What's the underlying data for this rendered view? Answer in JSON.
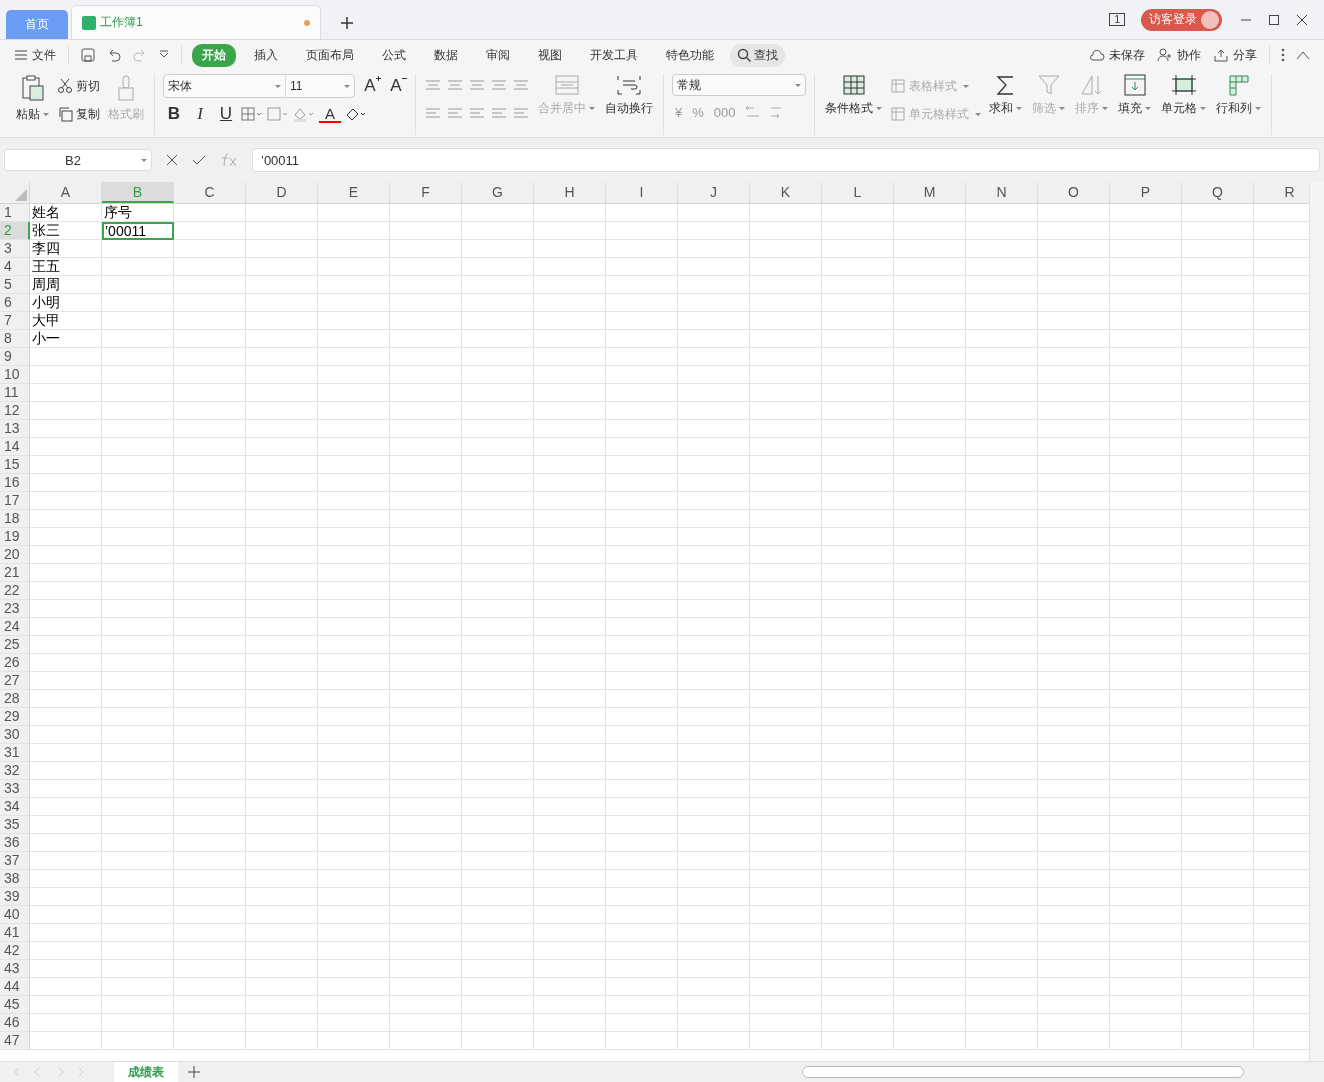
{
  "tabs": [
    {
      "label": "首页",
      "kind": "home",
      "selected": false,
      "modified": false
    },
    {
      "label": "工作簿1",
      "kind": "sheet",
      "selected": true,
      "modified": true
    }
  ],
  "title_bar": {
    "window_count": "1",
    "login": "访客登录"
  },
  "menu": {
    "file": "文件",
    "tabs": [
      {
        "label": "开始",
        "selected": true
      },
      {
        "label": "插入",
        "selected": false
      },
      {
        "label": "页面布局",
        "selected": false
      },
      {
        "label": "公式",
        "selected": false
      },
      {
        "label": "数据",
        "selected": false
      },
      {
        "label": "审阅",
        "selected": false
      },
      {
        "label": "视图",
        "selected": false
      },
      {
        "label": "开发工具",
        "selected": false
      },
      {
        "label": "特色功能",
        "selected": false
      }
    ],
    "search": "查找",
    "actions": [
      {
        "label": "未保存",
        "kind": "cloud"
      },
      {
        "label": "协作",
        "kind": "people"
      },
      {
        "label": "分享",
        "kind": "share"
      }
    ]
  },
  "ribbon": {
    "paste": "粘贴",
    "cut": "剪切",
    "copy": "复制",
    "format_painter": {
      "label": "格式刷",
      "disabled": true
    },
    "font": "宋体",
    "font_size": "11",
    "grow_font": "A",
    "shrink_font": "A",
    "styles": [
      "B",
      "I",
      "U"
    ],
    "font_color": {
      "label": "A",
      "color": "#ff0000"
    },
    "merge": {
      "label": "合并居中",
      "disabled": true
    },
    "wrap": {
      "label": "自动换行",
      "disabled": false
    },
    "number_format": "常规",
    "number_buttons": [
      "¥",
      "%",
      "000"
    ],
    "tools": [
      {
        "label": "条件格式",
        "kind": "grid",
        "disabled": false
      },
      {
        "label": "求和",
        "kind": "sum",
        "disabled": false
      },
      {
        "label": "筛选",
        "kind": "filter",
        "disabled": true
      },
      {
        "label": "排序",
        "kind": "sort",
        "disabled": true
      },
      {
        "label": "填充",
        "kind": "fill",
        "disabled": false
      },
      {
        "label": "单元格",
        "kind": "cell",
        "disabled": false
      },
      {
        "label": "行和列",
        "kind": "rowcol",
        "disabled": false
      }
    ],
    "styles_small": [
      {
        "label": "表格样式",
        "disabled": true
      },
      {
        "label": "单元格样式",
        "disabled": true
      }
    ]
  },
  "formula_bar": {
    "name_box": "B2",
    "value": "’00011"
  },
  "sheet": {
    "columns": [
      {
        "label": "A",
        "selected": false
      },
      {
        "label": "B",
        "selected": true
      },
      {
        "label": "C",
        "selected": false
      },
      {
        "label": "D",
        "selected": false
      },
      {
        "label": "E",
        "selected": false
      },
      {
        "label": "F",
        "selected": false
      },
      {
        "label": "G",
        "selected": false
      },
      {
        "label": "H",
        "selected": false
      },
      {
        "label": "I",
        "selected": false
      },
      {
        "label": "J",
        "selected": false
      },
      {
        "label": "K",
        "selected": false
      },
      {
        "label": "L",
        "selected": false
      },
      {
        "label": "M",
        "selected": false
      },
      {
        "label": "N",
        "selected": false
      },
      {
        "label": "O",
        "selected": false
      },
      {
        "label": "P",
        "selected": false
      },
      {
        "label": "Q",
        "selected": false
      },
      {
        "label": "R",
        "selected": false
      }
    ],
    "rows": [
      {
        "number": "1",
        "selected": false,
        "cells": [
          {
            "text": "姓名",
            "selected": false
          },
          {
            "text": "序号",
            "selected": false
          }
        ]
      },
      {
        "number": "2",
        "selected": true,
        "cells": [
          {
            "text": "张三",
            "selected": false
          },
          {
            "text": "’00011",
            "selected": true
          }
        ]
      },
      {
        "number": "3",
        "selected": false,
        "cells": [
          {
            "text": "李四",
            "selected": false
          }
        ]
      },
      {
        "number": "4",
        "selected": false,
        "cells": [
          {
            "text": "王五",
            "selected": false
          }
        ]
      },
      {
        "number": "5",
        "selected": false,
        "cells": [
          {
            "text": "周周",
            "selected": false
          }
        ]
      },
      {
        "number": "6",
        "selected": false,
        "cells": [
          {
            "text": "小明",
            "selected": false
          }
        ]
      },
      {
        "number": "7",
        "selected": false,
        "cells": [
          {
            "text": "大甲",
            "selected": false
          }
        ]
      },
      {
        "number": "8",
        "selected": false,
        "cells": [
          {
            "text": "小一",
            "selected": false
          }
        ]
      },
      {
        "number": "9",
        "selected": false
      },
      {
        "number": "10",
        "selected": false
      },
      {
        "number": "11",
        "selected": false
      },
      {
        "number": "12",
        "selected": false
      },
      {
        "number": "13",
        "selected": false
      },
      {
        "number": "14",
        "selected": false
      },
      {
        "number": "15",
        "selected": false
      },
      {
        "number": "16",
        "selected": false
      },
      {
        "number": "17",
        "selected": false
      },
      {
        "number": "18",
        "selected": false
      },
      {
        "number": "19",
        "selected": false
      },
      {
        "number": "20",
        "selected": false
      },
      {
        "number": "21",
        "selected": false
      },
      {
        "number": "22",
        "selected": false
      },
      {
        "number": "23",
        "selected": false
      },
      {
        "number": "24",
        "selected": false
      },
      {
        "number": "25",
        "selected": false
      },
      {
        "number": "26",
        "selected": false
      },
      {
        "number": "27",
        "selected": false
      },
      {
        "number": "28",
        "selected": false
      },
      {
        "number": "29",
        "selected": false
      },
      {
        "number": "30",
        "selected": false
      },
      {
        "number": "31",
        "selected": false
      },
      {
        "number": "32",
        "selected": false
      },
      {
        "number": "33",
        "selected": false
      },
      {
        "number": "34",
        "selected": false
      },
      {
        "number": "35",
        "selected": false
      },
      {
        "number": "36",
        "selected": false
      },
      {
        "number": "37",
        "selected": false
      },
      {
        "number": "38",
        "selected": false
      },
      {
        "number": "39",
        "selected": false
      },
      {
        "number": "40",
        "selected": false
      },
      {
        "number": "41",
        "selected": false
      },
      {
        "number": "42",
        "selected": false
      },
      {
        "number": "43",
        "selected": false
      },
      {
        "number": "44",
        "selected": false
      },
      {
        "number": "45",
        "selected": false
      },
      {
        "number": "46",
        "selected": false
      },
      {
        "number": "47",
        "selected": false
      }
    ]
  },
  "sheet_tabs": [
    {
      "label": "成绩表",
      "selected": true
    }
  ]
}
